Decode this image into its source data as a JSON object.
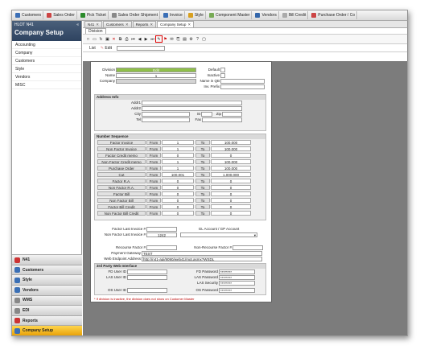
{
  "topbar": {
    "items": [
      {
        "label": "Customers",
        "color": "#3b6fb6"
      },
      {
        "label": "Sales Order",
        "color": "#c44"
      },
      {
        "label": "Pick Ticket",
        "color": "#2a8a2a"
      },
      {
        "label": "Sales Order Shipment",
        "color": "#888"
      },
      {
        "label": "Invoice",
        "color": "#3b6fb6"
      },
      {
        "label": "Style",
        "color": "#d8a020"
      },
      {
        "label": "Component Master",
        "color": "#7a5"
      },
      {
        "label": "Vendors",
        "color": "#36a"
      },
      {
        "label": "Bill Credit",
        "color": "#aaa"
      },
      {
        "label": "Purchase Order / Co",
        "color": "#c44"
      }
    ]
  },
  "sidebar": {
    "user": "HLOT N41",
    "title": "Company Setup",
    "items": [
      "Accounting",
      "Company",
      "Customers",
      "Style",
      "Vendors",
      "MISC"
    ]
  },
  "modules": [
    {
      "label": "N41",
      "color": "#c33"
    },
    {
      "label": "Customers",
      "color": "#3a6fb5"
    },
    {
      "label": "Style",
      "color": "#3a6fb5"
    },
    {
      "label": "Vendors",
      "color": "#3a6fb5"
    },
    {
      "label": "WMS",
      "color": "#888"
    },
    {
      "label": "EDI",
      "color": "#888"
    },
    {
      "label": "Reports",
      "color": "#c33"
    },
    {
      "label": "Company Setup",
      "color": "#3a6fb5"
    }
  ],
  "tabs": [
    "N41",
    "Customers",
    "Reports",
    "Company Setup"
  ],
  "subtab": "Division",
  "mode": {
    "list": "List",
    "edit": "Edit"
  },
  "form": {
    "division_label": "Division",
    "division_value": "Edit",
    "name_label": "Name",
    "name_value": "1",
    "company_label": "Company",
    "default_label": "Default",
    "inactive_label": "Inactive",
    "name_in_qb_label": "Name in QB",
    "inv_prefix_label": "Inv. Prefix",
    "address_title": "Address Info",
    "addr1": "Addr1",
    "addr2": "Addr2",
    "city": "City",
    "st": "St",
    "zip": "Zip",
    "tel": "Tel",
    "fax": "Fax",
    "ns_title": "Number Sequence",
    "ns_rows": [
      {
        "label": "Factor Invoice",
        "from": "1",
        "to": "100,000"
      },
      {
        "label": "Non Factor Invoice",
        "from": "1",
        "to": "100,000"
      },
      {
        "label": "Factor Credit memo",
        "from": "0",
        "to": "0"
      },
      {
        "label": "Non Factor Credit memo",
        "from": "1",
        "to": "100,000"
      },
      {
        "label": "Purchase Order",
        "from": "1",
        "to": "100,000"
      },
      {
        "label": "Cut",
        "from": "100,001",
        "to": "1,000,000"
      },
      {
        "label": "Factor R.A.",
        "from": "0",
        "to": "0"
      },
      {
        "label": "Non Factor R.A.",
        "from": "0",
        "to": "0"
      },
      {
        "label": "Factor Bill",
        "from": "0",
        "to": "0"
      },
      {
        "label": "Non Factor Bill",
        "from": "0",
        "to": "0"
      },
      {
        "label": "Factor Bill Credit",
        "from": "0",
        "to": "0"
      },
      {
        "label": "Non Factor Bill Credit",
        "from": "0",
        "to": "0"
      }
    ],
    "from_label": "From",
    "to_label": "To",
    "factor_last_inv": "Factor Last Invoice #",
    "nonfactor_last_inv": "Non Factor Last Invoice #",
    "nonfactor_last_inv_value": "1242",
    "gl_label": "GL Account / GP Account",
    "recourse_label": "Recourse Factor #",
    "nonrecourse_label": "Non-Recourse Factor #",
    "payment_label": "Payment Gateway",
    "payment_value": "TEST",
    "web_label": "Web Endpoint Address",
    "web_value": "http://n41-api/9090/web41/mgt.asmx?WSDL",
    "third_title": "3rd Party Web Interface",
    "fd_user": "FD User ID",
    "fd_pass": "FD Password",
    "fd_pass_val": "********",
    "las_user": "LAS User ID",
    "las_pass": "LAS Password",
    "las_pass_val": "********",
    "las_sec": "LAS Security",
    "las_sec_val": "********",
    "os_user": "OS User ID",
    "os_pass": "OS Password",
    "os_pass_val": "********",
    "note": "* If division is inactive, the division does not show on Customer Master"
  }
}
